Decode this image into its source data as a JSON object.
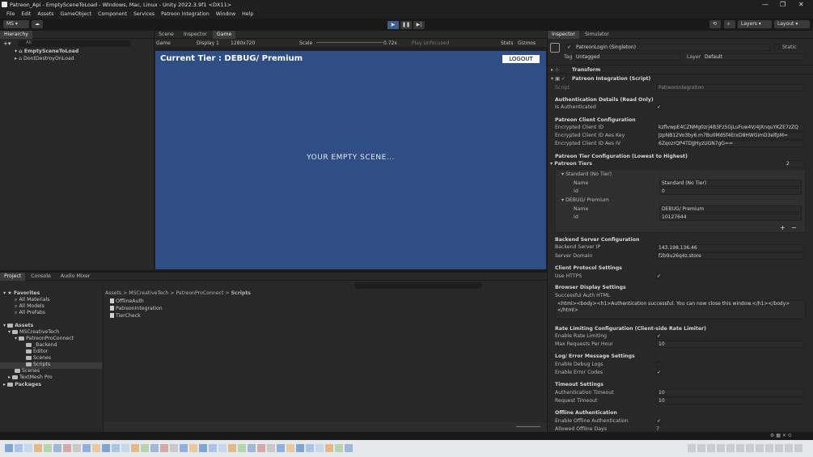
{
  "window": {
    "title": "Patreon_Api - EmptySceneToLoad - Windows, Mac, Linux - Unity 2022.3.9f1 <DX11>",
    "minimize": "—",
    "maximize": "❐",
    "close": "✕"
  },
  "menu": [
    "File",
    "Edit",
    "Assets",
    "GameObject",
    "Component",
    "Services",
    "Patreon Integration",
    "Window",
    "Help"
  ],
  "toolbar": {
    "account": "MS ▾",
    "layers": "Layers",
    "layout": "Layout"
  },
  "hierarchy": {
    "tab": "Hierarchy",
    "search_placeholder": "All",
    "items": [
      {
        "label": "EmptySceneToLoad"
      },
      {
        "label": "DontDestroyOnLoad"
      }
    ]
  },
  "scene_tabs": [
    "Scene",
    "Inspector",
    "Game"
  ],
  "game_toolbar": {
    "mode": "Game",
    "display": "Display 1",
    "resolution": "1280x720",
    "scale_label": "Scale",
    "scale_value": "0.72x",
    "play_focused": "Play Unfocused",
    "stats": "Stats",
    "gizmos": "Gizmos"
  },
  "game_view": {
    "tier_text": "Current Tier : DEBUG/ Premium",
    "logout": "LOGOUT",
    "center_text": "YOUR EMPTY SCENE...",
    "background": "#2f4e85"
  },
  "project": {
    "tabs": [
      "Project",
      "Console",
      "Audio Mixer"
    ],
    "favorites": [
      "Favorites",
      "All Materials",
      "All Models",
      "All Prefabs"
    ],
    "assets_tree": [
      "Assets",
      "MSCreativeTech",
      "PatreonProConnect",
      "_Backend",
      "Editor",
      "Scenes",
      "Scripts",
      "Scenes",
      "TextMesh Pro",
      "Packages"
    ],
    "breadcrumb": [
      "Assets",
      "MSCreativeTech",
      "PatreonProConnect",
      "Scripts"
    ],
    "files": [
      "OfflineAuth",
      "PatreonIntegration",
      "TierCheck"
    ]
  },
  "inspector": {
    "tabs": [
      "Inspector",
      "Simulator"
    ],
    "object_name": "PatreonLogin (Singleton)",
    "static": "Static",
    "tag_label": "Tag",
    "tag_value": "Untagged",
    "layer_label": "Layer",
    "layer_value": "Default",
    "transform": "Transform",
    "component": "Patreon Integration (Script)",
    "script_label": "Script",
    "script_value": "PatreonIntegration",
    "auth_details": "Authentication Details (Read Only)",
    "is_authenticated": "Is Authenticated",
    "client_config": "Patreon Client Configuration",
    "client_id_label": "Encrypted Client ID",
    "client_id": "kzflvwpE4CZNMg0zrj4B3Fz5GjLuFuw4V/4JXnquYKZE7zZQ",
    "aes_key_label": "Encrypted Client ID Aes Key",
    "aes_key": "JzpNB12Vo3by6.m7Bu0MdSf4ErxD8HWGimD3elfpM=",
    "aes_iv_label": "Encrypted Client ID Aes IV",
    "aes_iv": "6ZqozrQP4TDJJHyzUGN7gG==",
    "tier_config": "Patreon Tier Configuration (Lowest to Highest)",
    "patreon_tiers": "Patreon Tiers",
    "tiers_count": "2",
    "tier1_header": "Standard (No Tier)",
    "tier1_name": "Standard (No Tier)",
    "tier1_id": "0",
    "tier2_header": "DEBUG/ Premium",
    "tier2_name": "DEBUG/ Premium",
    "tier2_id": "10127644",
    "name_label": "Name",
    "id_label": "Id",
    "backend": "Backend Server Configuration",
    "backend_ip_label": "Backend Server IP",
    "backend_ip": "143.198.136.46",
    "server_domain_label": "Server Domain",
    "server_domain": "f2b9u26q4z.store",
    "protocol": "Client Protocol Settings",
    "use_https": "Use HTTPS",
    "browser": "Browser Display Settings",
    "success_html_label": "Successful Auth HTML",
    "success_html": "<html><body><h1>Authentication successful. You can now close this window.</h1></body></html>",
    "rate": "Rate Limiting Configuration (Client-side Rate Limiter)",
    "enable_rate": "Enable Rate Limiting",
    "max_requests_label": "Max Requests Per Hour",
    "max_requests": "10",
    "log": "Log/ Error Message Settings",
    "debug_logs": "Enable Debug Logs",
    "error_codes": "Enable Error Codes",
    "timeout": "Timeout Settings",
    "auth_timeout_label": "Authentication Timeout",
    "auth_timeout": "10",
    "req_timeout_label": "Request Timeout",
    "req_timeout": "10",
    "offline": "Offline Authentication",
    "enable_offline": "Enable Offline Authentication",
    "allowed_offline": "Allowed Offline Days",
    "allowed_offline_value": "7"
  }
}
